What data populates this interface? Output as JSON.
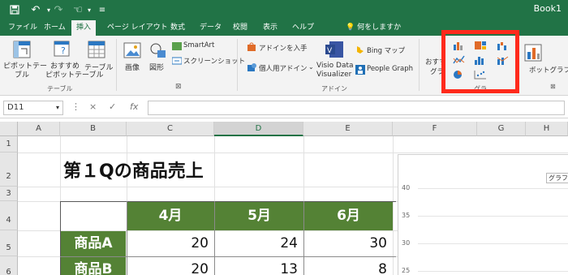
{
  "titlebar": {
    "book_name": "Book1"
  },
  "tabs": [
    "ファイル",
    "ホーム",
    "挿入",
    "ページ レイアウト",
    "数式",
    "データ",
    "校閲",
    "表示",
    "ヘルプ"
  ],
  "active_tab": "挿入",
  "tell_me": "何をしますか",
  "ribbon": {
    "pivot_line1": "ピボットテー",
    "pivot_line2": "ブル",
    "recommended_pivot_line1": "おすすめ",
    "recommended_pivot_line2": "ピボットテーブル",
    "table": "テーブル",
    "tables_group": "テーブル",
    "image": "画像",
    "shapes": "図形",
    "smartart": "SmartArt",
    "screenshot": "スクリーンショット",
    "get_addins": "アドインを入手",
    "my_addins": "個人用アドイン",
    "visio_line1": "Visio Data",
    "visio_line2": "Visualizer",
    "bing_maps": "Bing マップ",
    "people_graph": "People Graph",
    "addins_group": "アドイン",
    "recommended_charts_line1": "おすす",
    "recommended_charts_line2": "グラ",
    "charts_group": "グラ",
    "pivot_chart": "ボットグラフ"
  },
  "formula_bar": {
    "name_box": "D11",
    "cancel": "×",
    "enter": "✓",
    "fx": "fx",
    "value": ""
  },
  "columns": [
    "A",
    "B",
    "C",
    "D",
    "E",
    "F",
    "G",
    "H"
  ],
  "selected_column": "D",
  "rows": [
    "1",
    "2",
    "3",
    "4",
    "5",
    "6"
  ],
  "sheet": {
    "title": "第１Qの商品売上",
    "headers": [
      "4月",
      "5月",
      "6月"
    ],
    "products": [
      {
        "name": "商品A",
        "values": [
          "20",
          "24",
          "30"
        ]
      },
      {
        "name": "商品B",
        "values": [
          "20",
          "13",
          "8"
        ]
      }
    ]
  },
  "chart": {
    "tooltip": "グラフ",
    "y_ticks": [
      "40",
      "35",
      "30",
      "25"
    ]
  },
  "colors": {
    "excel_green": "#217346",
    "table_header_green": "#548235",
    "highlight_red": "#ff2a1c"
  }
}
